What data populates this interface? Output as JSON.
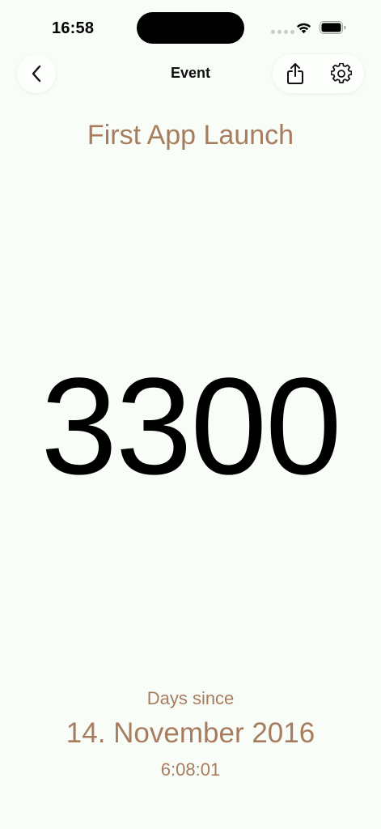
{
  "status_bar": {
    "time": "16:58",
    "wifi_icon": "wifi-icon",
    "battery_icon": "battery-icon"
  },
  "nav": {
    "title": "Event",
    "back_icon": "chevron-left-icon",
    "share_icon": "share-icon",
    "settings_icon": "gear-icon"
  },
  "event": {
    "title": "First App Launch",
    "count": "3300",
    "count_label": "Days since",
    "date": "14. November 2016",
    "time": "6:08:01"
  },
  "colors": {
    "background": "#F8FDF7",
    "accent": "#A87C5F",
    "count_text": "#000000"
  }
}
